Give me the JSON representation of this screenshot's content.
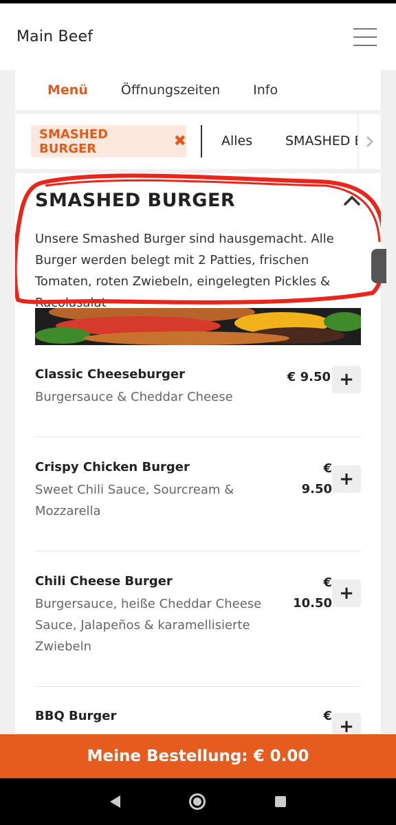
{
  "app": {
    "title": "Main Beef"
  },
  "tabs": [
    {
      "label": "Menü",
      "active": true
    },
    {
      "label": "Öffnungszeiten",
      "active": false
    },
    {
      "label": "Info",
      "active": false
    }
  ],
  "filter": {
    "active_chip": "SMASHED BURGER",
    "chip_close_icon": "✖",
    "items": [
      "Alles",
      "SMASHED B"
    ]
  },
  "category": {
    "title": "SMASHED BURGER",
    "description": "Unsere Smashed Burger sind hausgemacht. Alle Burger werden belegt mit 2 Patties, frischen Tomaten, roten Zwiebeln, eingelegten Pickles & Rucolasalat"
  },
  "items": [
    {
      "name": "Classic Cheeseburger",
      "description": "Burgersauce & Cheddar Cheese",
      "price": "€ 9.50"
    },
    {
      "name": "Crispy Chicken Burger",
      "description": "Sweet Chili Sauce, Sourcream & Mozzarella",
      "price_currency": "€",
      "price_value": "9.50"
    },
    {
      "name": "Chili Cheese Burger",
      "description": "Burgersauce, heiße Cheddar Cheese Sauce, Jalapeños & karamellisierte Zwiebeln",
      "price_currency": "€",
      "price_value": "10.50"
    },
    {
      "name": "BBQ Burger",
      "price_currency": "€"
    }
  ],
  "add_symbol": "+",
  "order": {
    "label": "Meine Bestellung: € 0.00"
  },
  "colors": {
    "accent": "#e25b1e",
    "order_bar": "#e65c1e",
    "chip_bg": "#fde8dd",
    "annotation": "#e8261c"
  }
}
